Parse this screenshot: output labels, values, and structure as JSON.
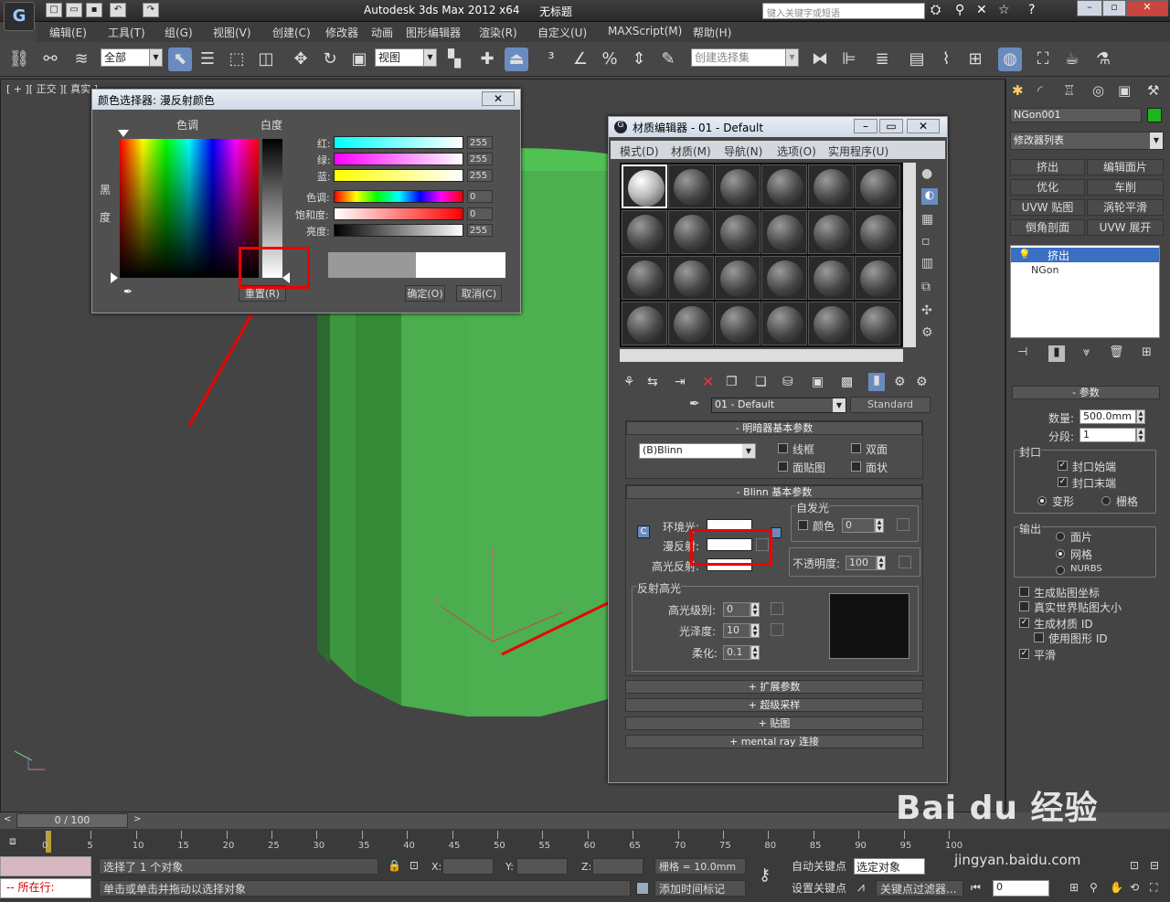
{
  "app": {
    "title": "Autodesk 3ds Max  2012 x64",
    "doc_title": "无标题",
    "search_placeholder": "键入关键字或短语",
    "logo": "G"
  },
  "menu": [
    "编辑(E)",
    "工具(T)",
    "组(G)",
    "视图(V)",
    "创建(C)",
    "修改器",
    "动画",
    "图形编辑器",
    "渲染(R)",
    "自定义(U)",
    "MAXScript(M)",
    "帮助(H)"
  ],
  "toolbar": {
    "filter_value": "全部",
    "ref_coord_value": "视图",
    "selection_set_placeholder": "创建选择集"
  },
  "viewport": {
    "label": "[ + ][ 正交 ][ 真实 ]",
    "axis_x": "x",
    "axis_y": "y",
    "axis_z": "z"
  },
  "color_dialog": {
    "title": "颜色选择器: 漫反射颜色",
    "hue_label": "色调",
    "white_label": "白度",
    "black_label": "黑\n度",
    "rows": [
      {
        "label": "红:",
        "value": "255"
      },
      {
        "label": "绿:",
        "value": "255"
      },
      {
        "label": "蓝:",
        "value": "255"
      },
      {
        "label": "色调:",
        "value": "0"
      },
      {
        "label": "饱和度:",
        "value": "0"
      },
      {
        "label": "亮度:",
        "value": "255"
      }
    ],
    "reset": "重置(R)",
    "ok": "确定(O)",
    "cancel": "取消(C)"
  },
  "mat_editor": {
    "title": "材质编辑器 - 01 - Default",
    "menu": [
      "模式(D)",
      "材质(M)",
      "导航(N)",
      "选项(O)",
      "实用程序(U)"
    ],
    "material_name": "01 - Default",
    "material_type": "Standard",
    "shader_rollout": "明暗器基本参数",
    "shader": "(B)Blinn",
    "wire": "线框",
    "two_sided": "双面",
    "face_map": "面贴图",
    "faceted": "面状",
    "blinn_rollout": "Blinn 基本参数",
    "self_illum": "自发光",
    "color": "颜色",
    "color_value": "0",
    "ambient": "环境光:",
    "diffuse": "漫反射:",
    "specular": "高光反射:",
    "opacity_label": "不透明度:",
    "opacity_value": "100",
    "spec_hl": "反射高光",
    "spec_level": "高光级别:",
    "spec_level_value": "0",
    "gloss": "光泽度:",
    "gloss_value": "10",
    "soften": "柔化:",
    "soften_value": "0.1",
    "rollouts": [
      "扩展参数",
      "超级采样",
      "贴图",
      "mental ray 连接"
    ]
  },
  "command_panel": {
    "object_name": "NGon001",
    "object_color": "#1db41d",
    "modifier_list": "修改器列表",
    "buttons": [
      "挤出",
      "编辑面片",
      "优化",
      "车削",
      "UVW 贴图",
      "涡轮平滑",
      "倒角剖面",
      "UVW 展开"
    ],
    "stack": [
      "挤出",
      "NGon"
    ],
    "params_title": "参数",
    "amount_label": "数量:",
    "amount_value": "500.0mm",
    "segments_label": "分段:",
    "segments_value": "1",
    "capping": "封口",
    "cap_start": "封口始端",
    "cap_end": "封口末端",
    "morph": "变形",
    "grid": "栅格",
    "output": "输出",
    "patch": "面片",
    "mesh": "网格",
    "nurbs": "NURBS",
    "gen_map": "生成贴图坐标",
    "real_world": "真实世界贴图大小",
    "gen_mat": "生成材质 ID",
    "use_shape": "使用图形 ID",
    "smooth": "平滑"
  },
  "timeline": {
    "frame": "0 / 100",
    "ticks": [
      "0",
      "5",
      "10",
      "15",
      "20",
      "25",
      "30",
      "35",
      "40",
      "45",
      "50",
      "55",
      "60",
      "65",
      "70",
      "75",
      "80",
      "85",
      "90",
      "95",
      "100"
    ]
  },
  "status": {
    "selected": "选择了 1 个对象",
    "prompt": "单击或单击并拖动以选择对象",
    "running": "所在行:",
    "x_label": "X:",
    "y_label": "Y:",
    "z_label": "Z:",
    "grid": "栅格 = 10.0mm",
    "add_time_tag": "添加时间标记",
    "auto_key": "自动关键点",
    "set_key": "设置关键点",
    "selected_obj": "选定对象",
    "key_filters": "关键点过滤器...",
    "frame_value": "0"
  },
  "watermark": {
    "brand": "Bai du 经验",
    "url": "jingyan.baidu.com"
  }
}
